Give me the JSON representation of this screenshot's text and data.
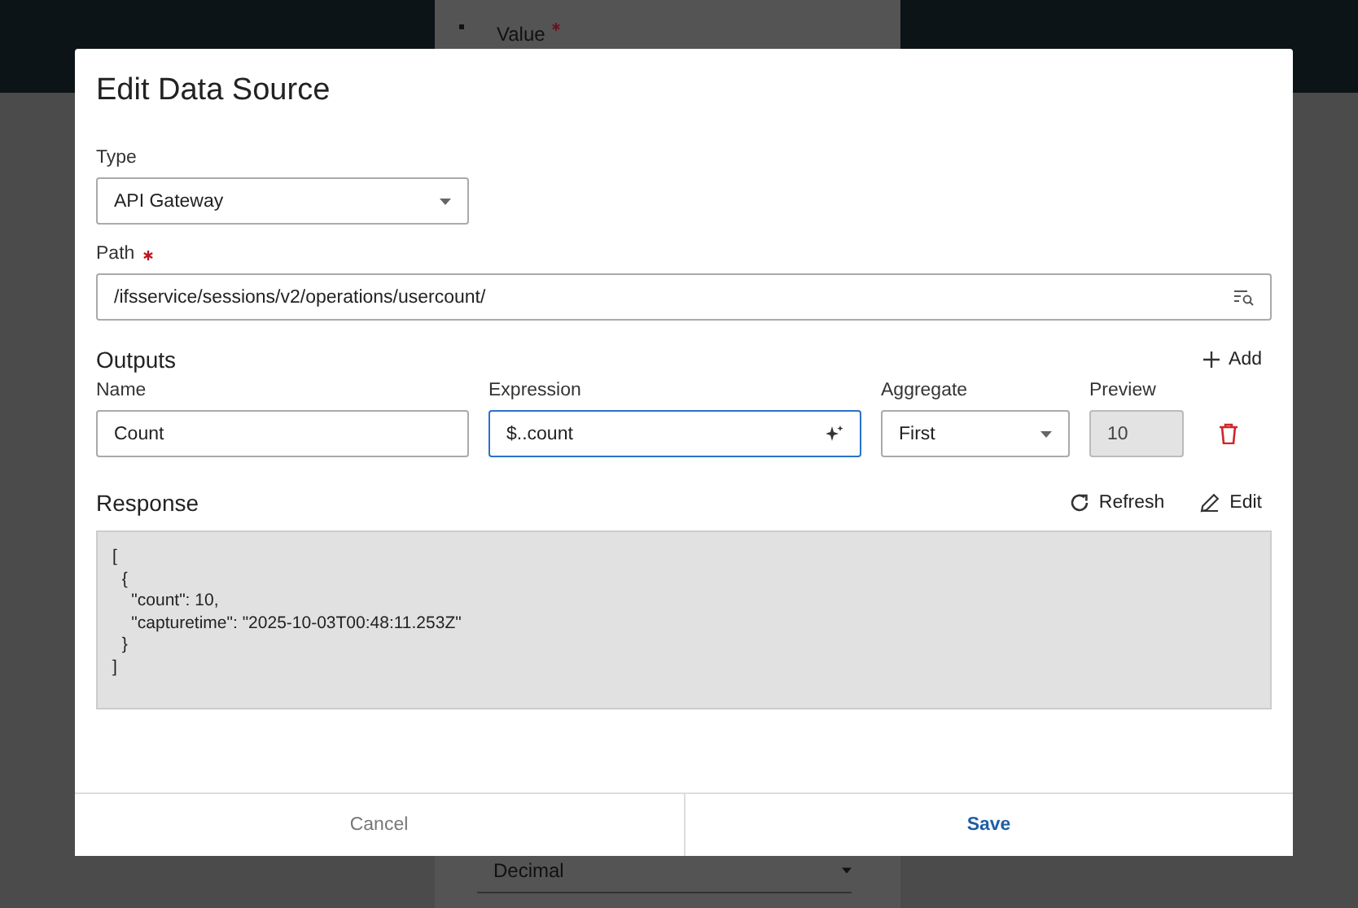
{
  "background": {
    "texts": [
      "Value"
    ],
    "value_required": true,
    "dropdown_value": "Decimal"
  },
  "dialog": {
    "title": "Edit Data Source",
    "type_field": {
      "label": "Type",
      "value": "API Gateway"
    },
    "path_field": {
      "label": "Path",
      "required": true,
      "value": "/ifsservice/sessions/v2/operations/usercount/"
    },
    "outputs": {
      "title": "Outputs",
      "add_label": "Add",
      "columns": [
        "Name",
        "Expression",
        "Aggregate",
        "Preview"
      ],
      "rows": [
        {
          "name": "Count",
          "expression": "$..count",
          "expression_focused": true,
          "aggregate": "First",
          "preview": "10",
          "preview_disabled": true
        }
      ]
    },
    "response": {
      "title": "Response",
      "actions": [
        "Refresh",
        "Edit"
      ],
      "lines": [
        "[",
        "  {",
        "    \"count\": 10,",
        "    \"capturetime\": \"2025-10-03T00:48:11.253Z\"",
        "  }",
        "]"
      ]
    },
    "buttons": [
      {
        "label": "Cancel",
        "primary": false
      },
      {
        "label": "Save",
        "primary": true
      }
    ]
  }
}
